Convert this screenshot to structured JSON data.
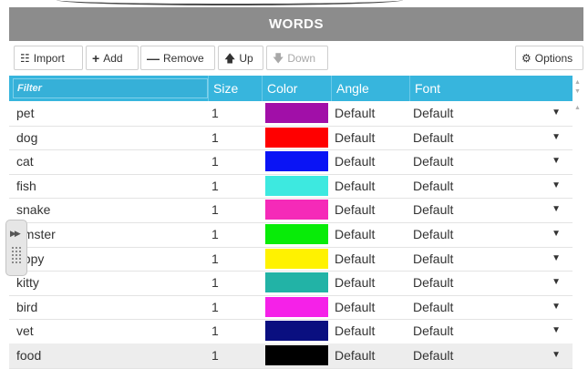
{
  "title": "WORDS",
  "toolbar": {
    "import_label": "Import",
    "add_label": "Add",
    "remove_label": "Remove",
    "up_label": "Up",
    "down_label": "Down",
    "options_label": "Options"
  },
  "table": {
    "filter_placeholder": "Filter",
    "headers": {
      "size": "Size",
      "color": "Color",
      "angle": "Angle",
      "font": "Font"
    },
    "rows": [
      {
        "word": "pet",
        "size": "1",
        "color": "#a10fa8",
        "angle": "Default",
        "font": "Default"
      },
      {
        "word": "dog",
        "size": "1",
        "color": "#ff0000",
        "angle": "Default",
        "font": "Default"
      },
      {
        "word": "cat",
        "size": "1",
        "color": "#0a14f5",
        "angle": "Default",
        "font": "Default"
      },
      {
        "word": "fish",
        "size": "1",
        "color": "#3de9e0",
        "angle": "Default",
        "font": "Default"
      },
      {
        "word": "snake",
        "size": "1",
        "color": "#f52ab8",
        "angle": "Default",
        "font": "Default"
      },
      {
        "word": "amster",
        "size": "1",
        "color": "#08ec08",
        "angle": "Default",
        "font": "Default"
      },
      {
        "word": "uppy",
        "size": "1",
        "color": "#fff200",
        "angle": "Default",
        "font": "Default"
      },
      {
        "word": "kitty",
        "size": "1",
        "color": "#22b3a6",
        "angle": "Default",
        "font": "Default"
      },
      {
        "word": "bird",
        "size": "1",
        "color": "#f521e8",
        "angle": "Default",
        "font": "Default"
      },
      {
        "word": "vet",
        "size": "1",
        "color": "#0a0f80",
        "angle": "Default",
        "font": "Default"
      },
      {
        "word": "food",
        "size": "1",
        "color": "#000000",
        "angle": "Default",
        "font": "Default"
      }
    ]
  },
  "colors": {
    "title_bar": "#8c8c8c",
    "header_accent": "#37b5dd"
  },
  "icons": {
    "import": "database-icon",
    "add": "plus-icon",
    "remove": "minus-icon",
    "up": "arrow-up-icon",
    "down": "arrow-down-icon",
    "options": "gear-icon",
    "font_dropdown": "chevron-down-icon"
  }
}
